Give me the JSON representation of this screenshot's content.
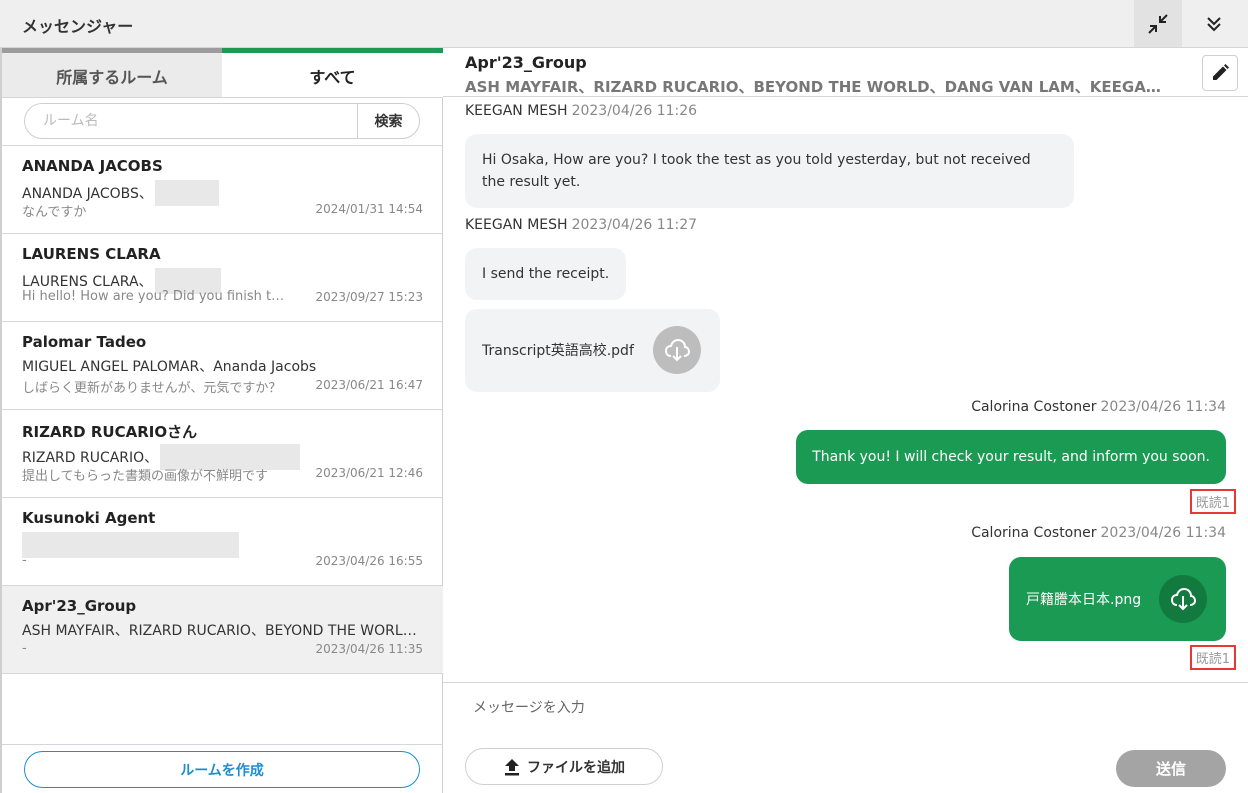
{
  "window": {
    "title": "メッセンジャー",
    "minimize_icon": "collapse-arrows-icon",
    "collapse_icon": "double-chevron-down-icon"
  },
  "tabs": [
    {
      "label": "所属するルーム",
      "active": false
    },
    {
      "label": "すべて",
      "active": true
    }
  ],
  "search": {
    "placeholder": "ルーム名",
    "button_label": "検索"
  },
  "rooms": [
    {
      "name": "ANANDA JACOBS",
      "members": "ANANDA JACOBS、",
      "preview": "なんですか",
      "date": "2024/01/31 14:54"
    },
    {
      "name": "LAURENS CLARA",
      "members": "LAURENS CLARA、",
      "preview": "Hi hello! How are you? Did you finish the documents?",
      "date": "2023/09/27 15:23"
    },
    {
      "name": "Palomar Tadeo",
      "members": "MIGUEL ANGEL PALOMAR、Ananda Jacobs",
      "preview": "しばらく更新がありませんが、元気ですか？",
      "date": "2023/06/21 16:47"
    },
    {
      "name": "RIZARD RUCARIOさん",
      "members": "RIZARD RUCARIO、",
      "preview": "提出してもらった書類の画像が不鮮明です",
      "date": "2023/06/21 12:46"
    },
    {
      "name": "Kusunoki Agent",
      "members": "",
      "preview": "-",
      "date": "2023/04/26 16:55"
    },
    {
      "name": "Apr'23_Group",
      "members": "ASH MAYFAIR、RIZARD RUCARIO、BEYOND THE WORLD、DANG VAN LAM、KEEGAN MESH",
      "preview": "-",
      "date": "2023/04/26 11:35",
      "active": true
    }
  ],
  "create_room_label": "ルームを作成",
  "chat": {
    "title": "Apr'23_Group",
    "members": "ASH MAYFAIR、RIZARD RUCARIO、BEYOND THE WORLD、DANG VAN LAM、KEEGAN MESH",
    "edit_icon": "pencil-icon",
    "messages": [
      {
        "sender": "KEEGAN MESH",
        "time": "2023/04/26 11:26",
        "text": "Hi Osaka, How are you? I took the test as you told yesterday, but not received the result yet."
      },
      {
        "sender": "KEEGAN MESH",
        "time": "2023/04/26 11:27",
        "text": "I send the receipt.",
        "file": "Transcript英語高校.pdf"
      },
      {
        "sender": "Calorina Costoner",
        "time": "2023/04/26 11:34",
        "text": "Thank you! I will check your result, and inform you soon.",
        "read": "既読1"
      },
      {
        "sender": "Calorina Costoner",
        "time": "2023/04/26 11:34",
        "file": "戸籍謄本日本.png",
        "read": "既読1"
      }
    ]
  },
  "composer": {
    "placeholder": "メッセージを入力",
    "add_file_label": "ファイルを追加",
    "send_label": "送信"
  },
  "colors": {
    "accent_green": "#1a9a52",
    "link_blue": "#1a8fd0",
    "read_highlight": "#e53935"
  }
}
